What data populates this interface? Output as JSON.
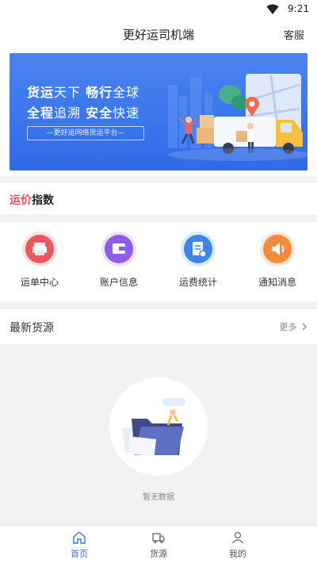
{
  "status_bar": {
    "time": "9:21"
  },
  "header": {
    "title": "更好运司机端",
    "service_label": "客服"
  },
  "banner": {
    "line1_a": "货运",
    "line1_b": "天下 ",
    "line1_c": "畅行",
    "line1_d": "全球",
    "line2_a": "全程",
    "line2_b": "追溯 ",
    "line2_c": "安全",
    "line2_d": "快速",
    "slogan": "—更好运网络货运平台—"
  },
  "price_index": {
    "accent": "运价",
    "rest": "指数",
    "accent_color": "#e84a5f"
  },
  "menu": [
    {
      "label": "运单中心",
      "icon": "printer-icon",
      "color": "#f0565e"
    },
    {
      "label": "账户信息",
      "icon": "wallet-icon",
      "color": "#8e5ce6"
    },
    {
      "label": "运费统计",
      "icon": "document-icon",
      "color": "#3c86ea"
    },
    {
      "label": "通知消息",
      "icon": "speaker-icon",
      "color": "#f38b3c"
    }
  ],
  "latest": {
    "title": "最新货源",
    "more_label": "更多"
  },
  "empty": {
    "text": "暂无数据"
  },
  "tabbar": [
    {
      "label": "首页",
      "icon": "home-icon",
      "active": true
    },
    {
      "label": "货源",
      "icon": "truck-icon",
      "active": false
    },
    {
      "label": "我的",
      "icon": "user-icon",
      "active": false
    }
  ],
  "colors": {
    "primary": "#3a6ff0",
    "banner": "#2f6be6"
  }
}
